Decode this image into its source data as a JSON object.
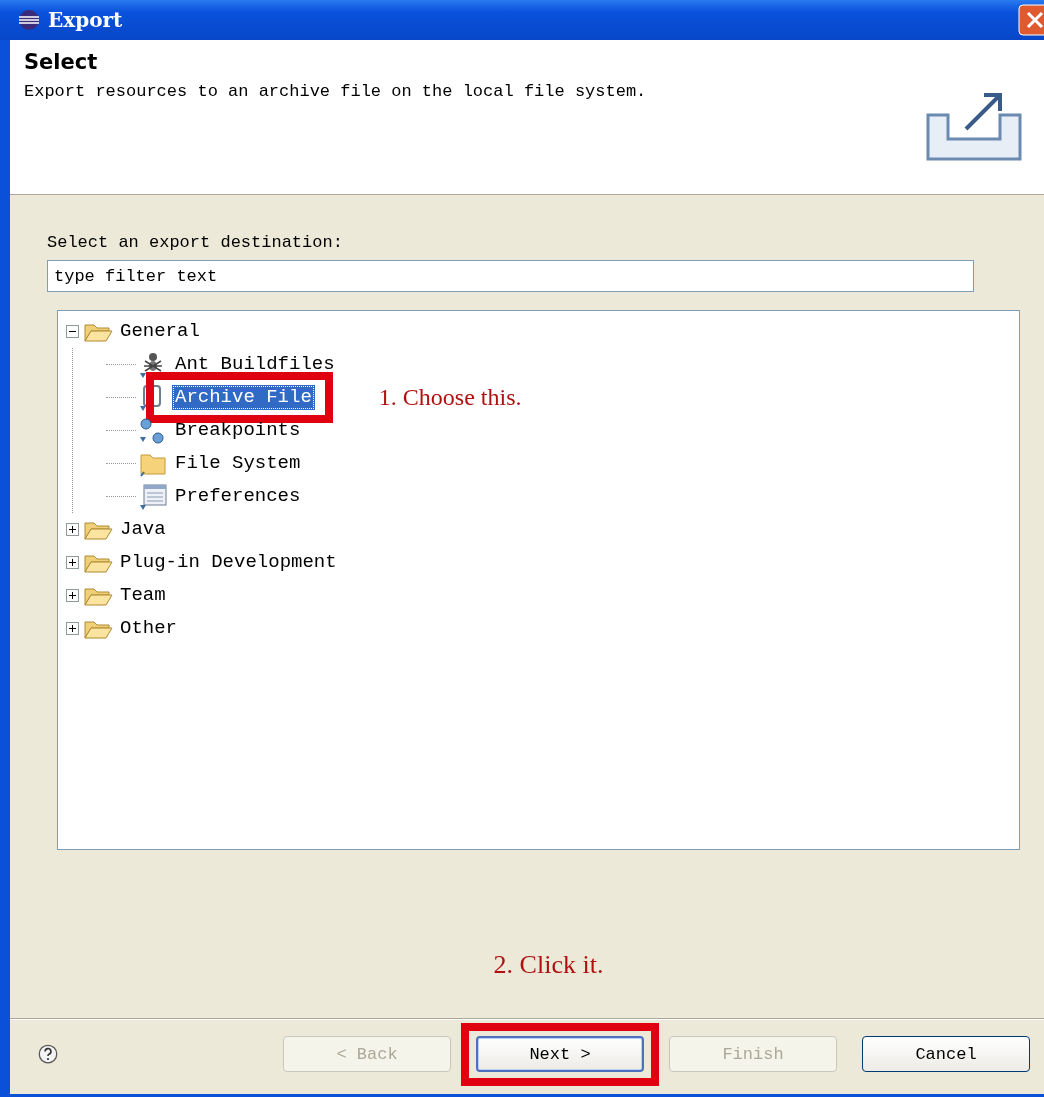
{
  "window": {
    "title": "Export"
  },
  "header": {
    "title": "Select",
    "description": "Export resources to an archive file on the local file system."
  },
  "filter": {
    "label": "Select an export destination:",
    "value": "type filter text"
  },
  "tree": [
    {
      "label": "General",
      "kind": "folder",
      "expanded": true,
      "selected": false,
      "highlighted": false,
      "children": [
        {
          "label": "Ant Buildfiles",
          "kind": "ant",
          "selected": false,
          "highlighted": false
        },
        {
          "label": "Archive File",
          "kind": "archive",
          "selected": true,
          "highlighted": true,
          "note": "1. Choose this."
        },
        {
          "label": "Breakpoints",
          "kind": "breakpoints",
          "selected": false,
          "highlighted": false
        },
        {
          "label": "File System",
          "kind": "folder-closed",
          "selected": false,
          "highlighted": false
        },
        {
          "label": "Preferences",
          "kind": "preferences",
          "selected": false,
          "highlighted": false
        }
      ]
    },
    {
      "label": "Java",
      "kind": "folder",
      "expanded": false,
      "selected": false,
      "highlighted": false
    },
    {
      "label": "Plug-in Development",
      "kind": "folder",
      "expanded": false,
      "selected": false,
      "highlighted": false
    },
    {
      "label": "Team",
      "kind": "folder",
      "expanded": false,
      "selected": false,
      "highlighted": false
    },
    {
      "label": "Other",
      "kind": "folder",
      "expanded": false,
      "selected": false,
      "highlighted": false
    }
  ],
  "footer_note": "2. Click it.",
  "buttons": [
    {
      "label": "< Back",
      "disabled": true,
      "default": false,
      "highlighted": false
    },
    {
      "label": "Next >",
      "disabled": false,
      "default": true,
      "highlighted": true
    },
    {
      "label": "Finish",
      "disabled": true,
      "default": false,
      "highlighted": false
    },
    {
      "label": "Cancel",
      "disabled": false,
      "default": false,
      "highlighted": false
    }
  ]
}
